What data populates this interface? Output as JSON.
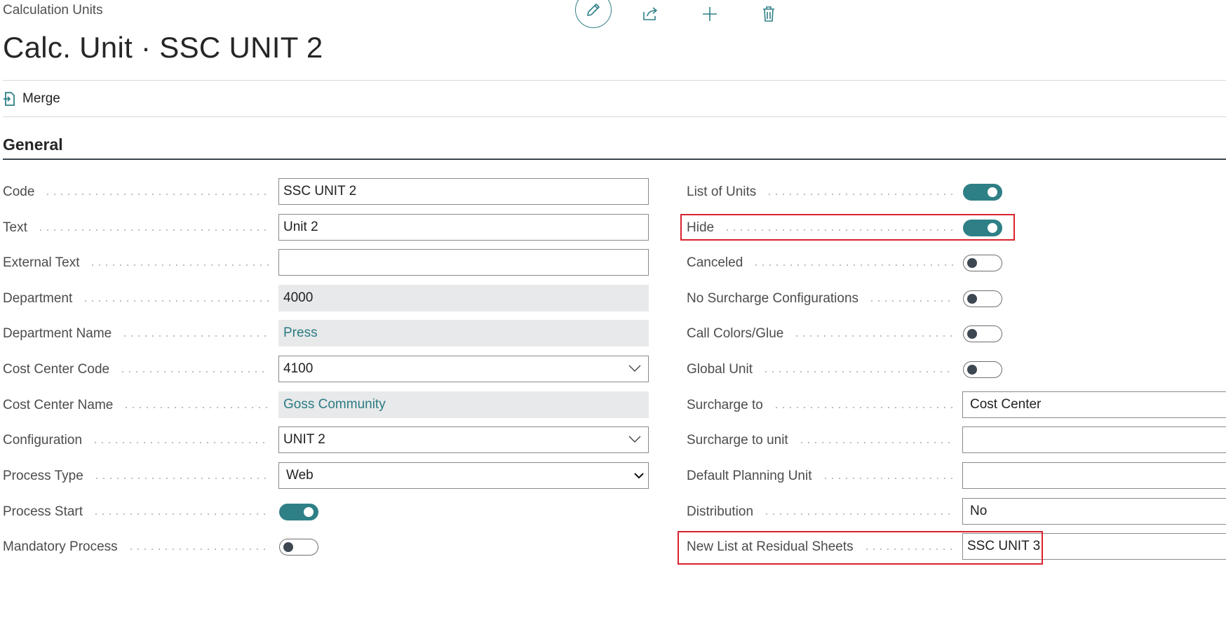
{
  "breadcrumb": "Calculation Units",
  "page_title": "Calc. Unit · SSC UNIT 2",
  "actions": {
    "merge_label": "Merge"
  },
  "section": {
    "title": "General"
  },
  "left_fields": {
    "code": {
      "label": "Code",
      "value": "SSC UNIT 2"
    },
    "text": {
      "label": "Text",
      "value": "Unit 2"
    },
    "external_text": {
      "label": "External Text",
      "value": ""
    },
    "department": {
      "label": "Department",
      "value": "4000"
    },
    "department_name": {
      "label": "Department Name",
      "value": "Press"
    },
    "cost_center_code": {
      "label": "Cost Center Code",
      "value": "4100"
    },
    "cost_center_name": {
      "label": "Cost Center Name",
      "value": "Goss Community"
    },
    "configuration": {
      "label": "Configuration",
      "value": "UNIT 2"
    },
    "process_type": {
      "label": "Process Type",
      "value": "Web"
    },
    "process_start": {
      "label": "Process Start",
      "state": "on"
    },
    "mandatory_process": {
      "label": "Mandatory Process",
      "state": "off"
    }
  },
  "right_fields": {
    "list_of_units": {
      "label": "List of Units",
      "state": "on"
    },
    "hide": {
      "label": "Hide",
      "state": "on"
    },
    "canceled": {
      "label": "Canceled",
      "state": "off"
    },
    "no_surcharge": {
      "label": "No Surcharge Configurations",
      "state": "off"
    },
    "call_colors": {
      "label": "Call Colors/Glue",
      "state": "off"
    },
    "global_unit": {
      "label": "Global Unit",
      "state": "off"
    },
    "surcharge_to": {
      "label": "Surcharge to",
      "value": "Cost Center"
    },
    "surcharge_to_unit": {
      "label": "Surcharge to unit",
      "value": ""
    },
    "default_planning_unit": {
      "label": "Default Planning Unit",
      "value": ""
    },
    "distribution": {
      "label": "Distribution",
      "value": "No"
    },
    "new_list_residual": {
      "label": "New List at Residual Sheets",
      "value": "SSC UNIT 3"
    }
  },
  "colors": {
    "accent": "#2f7f86",
    "highlight": "#d9232e",
    "readonly_bg": "#e8e9ea"
  }
}
